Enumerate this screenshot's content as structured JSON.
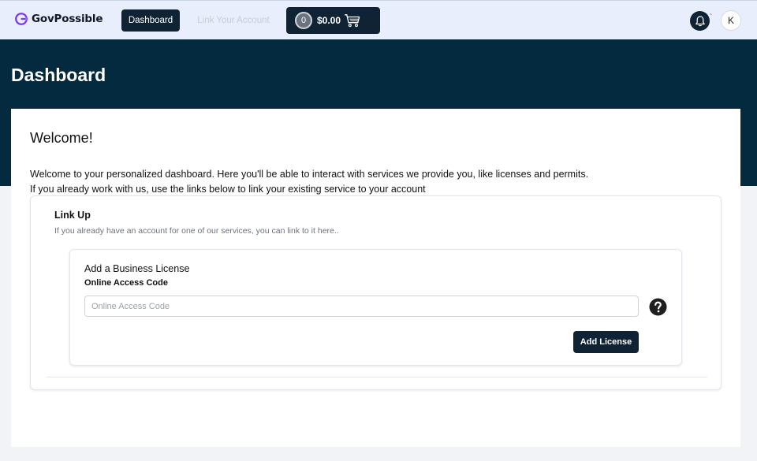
{
  "brand": {
    "name": "GovPossible",
    "color": "#7c3aed",
    "icon": "govpossible-logo-icon"
  },
  "nav": {
    "dashboard_label": "Dashboard",
    "link_account_label": "Link Your Account"
  },
  "cart": {
    "count": "0",
    "total": "$0.00",
    "icon": "cart-icon"
  },
  "header_icons": {
    "bell": "bell-icon",
    "bell_mark": "`",
    "avatar_initial": "K"
  },
  "page": {
    "title": "Dashboard"
  },
  "main": {
    "welcome": "Welcome!",
    "intro_line1": "Welcome to your personalized dashboard. Here you'll be able to interact with services we provide you, like licenses and permits.",
    "intro_line2": "If you already work with us, use the links below to link your existing service to your account"
  },
  "link_up": {
    "title": "Link Up",
    "subtitle": "If you already have an account for one of our services, you can link to it here..",
    "license": {
      "title": "Add a Business License",
      "field_label": "Online Access Code",
      "placeholder": "Online Access Code",
      "value": "",
      "help_icon": "question-circle-icon",
      "button_label": "Add License"
    }
  },
  "colors": {
    "primary_dark": "#0f2335",
    "hero": "#042a40",
    "nav_bg": "#e8eefb"
  }
}
